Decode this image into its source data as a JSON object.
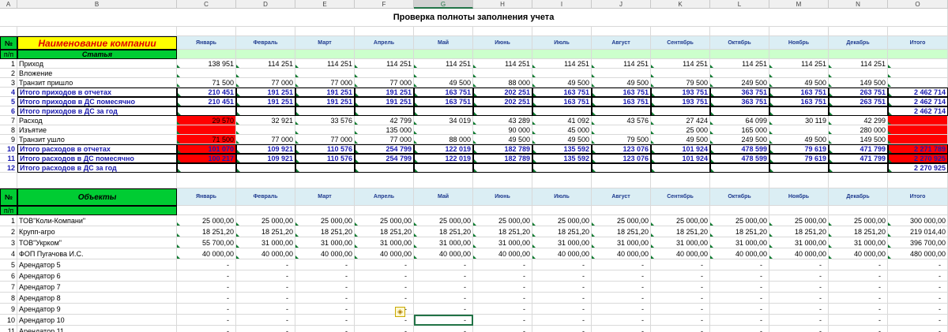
{
  "columns": [
    "A",
    "B",
    "C",
    "D",
    "E",
    "F",
    "G",
    "H",
    "I",
    "J",
    "K",
    "L",
    "M",
    "N",
    "O"
  ],
  "selected_column": "G",
  "title": "Проверка полноты заполнения учета",
  "months": [
    "Январь",
    "Февраль",
    "Март",
    "Апрель",
    "Май",
    "Июнь",
    "Июль",
    "Август",
    "Сентябрь",
    "Октябрь",
    "Ноябрь",
    "Декабрь",
    "Итого"
  ],
  "top": {
    "num_hdr": "№",
    "sub_num_hdr": "п/п",
    "company_hdr": "Наименование компании",
    "article_hdr": "Статья",
    "rows": [
      {
        "n": "1",
        "label": "Приход",
        "style": "plain",
        "vals": [
          "138 951",
          "114 251",
          "114 251",
          "114 251",
          "114 251",
          "114 251",
          "114 251",
          "114 251",
          "114 251",
          "114 251",
          "114 251",
          "114 251",
          ""
        ]
      },
      {
        "n": "2",
        "label": "Вложение",
        "style": "plain",
        "vals": [
          "",
          "",
          "",
          "",
          "",
          "",
          "",
          "",
          "",
          "",
          "",
          "",
          ""
        ]
      },
      {
        "n": "3",
        "label": "Транзит пришло",
        "style": "plain",
        "vals": [
          "71 500",
          "77 000",
          "77 000",
          "77 000",
          "49 500",
          "88 000",
          "49 500",
          "49 500",
          "79 500",
          "249 500",
          "49 500",
          "149 500",
          ""
        ]
      },
      {
        "n": "4",
        "label": "Итого приходов в отчетах",
        "style": "total",
        "vals": [
          "210 451",
          "191 251",
          "191 251",
          "191 251",
          "163 751",
          "202 251",
          "163 751",
          "163 751",
          "193 751",
          "363 751",
          "163 751",
          "263 751",
          "2 462 714"
        ]
      },
      {
        "n": "5",
        "label": "Итого приходов в ДС помесячно",
        "style": "total",
        "vals": [
          "210 451",
          "191 251",
          "191 251",
          "191 251",
          "163 751",
          "202 251",
          "163 751",
          "163 751",
          "193 751",
          "363 751",
          "163 751",
          "263 751",
          "2 462 714"
        ]
      },
      {
        "n": "6",
        "label": "Итого приходов в ДС за год",
        "style": "year",
        "vals": [
          "",
          "",
          "",
          "",
          "",
          "",
          "",
          "",
          "",
          "",
          "",
          "",
          "2 462 714"
        ]
      },
      {
        "n": "7",
        "label": "Расход",
        "style": "plain",
        "vals": [
          "29 570",
          "32 921",
          "33 576",
          "42 799",
          "34 019",
          "43 289",
          "41 092",
          "43 576",
          "27 424",
          "64 099",
          "30 119",
          "42 299",
          ""
        ]
      },
      {
        "n": "8",
        "label": "Изъятие",
        "style": "plain",
        "vals": [
          "",
          "",
          "",
          "135 000",
          "",
          "90 000",
          "45 000",
          "",
          "25 000",
          "165 000",
          "",
          "280 000",
          ""
        ]
      },
      {
        "n": "9",
        "label": "Транзит ушло",
        "style": "plain",
        "vals": [
          "71 500",
          "77 000",
          "77 000",
          "77 000",
          "88 000",
          "49 500",
          "49 500",
          "79 500",
          "49 500",
          "249 500",
          "49 500",
          "149 500",
          ""
        ]
      },
      {
        "n": "10",
        "label": "Итого расходов в отчетах",
        "style": "total",
        "vals": [
          "101 070",
          "109 921",
          "110 576",
          "254 799",
          "122 019",
          "182 789",
          "135 592",
          "123 076",
          "101 924",
          "478 599",
          "79 619",
          "471 799",
          "2 271 789"
        ]
      },
      {
        "n": "11",
        "label": "Итого расходов в ДС помесячно",
        "style": "total",
        "vals": [
          "100 217",
          "109 921",
          "110 576",
          "254 799",
          "122 019",
          "182 789",
          "135 592",
          "123 076",
          "101 924",
          "478 599",
          "79 619",
          "471 799",
          "2 270 925"
        ]
      },
      {
        "n": "12",
        "label": "Итого расходов в ДС за год",
        "style": "year",
        "vals": [
          "",
          "",
          "",
          "",
          "",
          "",
          "",
          "",
          "",
          "",
          "",
          "",
          "2 270 925"
        ]
      }
    ]
  },
  "objects": {
    "num_hdr": "№",
    "sub_num_hdr": "п/п",
    "objects_hdr": "Объекты",
    "rows": [
      {
        "n": "1",
        "label": "ТОВ\"Коли-Компани\"",
        "vals": [
          "25 000,00",
          "25 000,00",
          "25 000,00",
          "25 000,00",
          "25 000,00",
          "25 000,00",
          "25 000,00",
          "25 000,00",
          "25 000,00",
          "25 000,00",
          "25 000,00",
          "25 000,00",
          "300 000,00"
        ]
      },
      {
        "n": "2",
        "label": "Крупп-агро",
        "vals": [
          "18 251,20",
          "18 251,20",
          "18 251,20",
          "18 251,20",
          "18 251,20",
          "18 251,20",
          "18 251,20",
          "18 251,20",
          "18 251,20",
          "18 251,20",
          "18 251,20",
          "18 251,20",
          "219 014,40"
        ]
      },
      {
        "n": "3",
        "label": "ТОВ\"Укрком\"",
        "vals": [
          "55 700,00",
          "31 000,00",
          "31 000,00",
          "31 000,00",
          "31 000,00",
          "31 000,00",
          "31 000,00",
          "31 000,00",
          "31 000,00",
          "31 000,00",
          "31 000,00",
          "31 000,00",
          "396 700,00"
        ]
      },
      {
        "n": "4",
        "label": "ФОП Пугачова И.С.",
        "vals": [
          "40 000,00",
          "40 000,00",
          "40 000,00",
          "40 000,00",
          "40 000,00",
          "40 000,00",
          "40 000,00",
          "40 000,00",
          "40 000,00",
          "40 000,00",
          "40 000,00",
          "40 000,00",
          "480 000,00"
        ]
      },
      {
        "n": "5",
        "label": "Арендатор 5",
        "vals": [
          "-",
          "-",
          "-",
          "-",
          "-",
          "-",
          "-",
          "-",
          "-",
          "-",
          "-",
          "-",
          "-"
        ]
      },
      {
        "n": "6",
        "label": "Арендатор 6",
        "vals": [
          "-",
          "-",
          "-",
          "-",
          "-",
          "-",
          "-",
          "-",
          "-",
          "-",
          "-",
          "-",
          "-"
        ]
      },
      {
        "n": "7",
        "label": "Арендатор 7",
        "vals": [
          "-",
          "-",
          "-",
          "-",
          "-",
          "-",
          "-",
          "-",
          "-",
          "-",
          "-",
          "-",
          "-"
        ]
      },
      {
        "n": "8",
        "label": "Арендатор 8",
        "vals": [
          "-",
          "-",
          "-",
          "-",
          "-",
          "-",
          "-",
          "-",
          "-",
          "-",
          "-",
          "-",
          "-"
        ]
      },
      {
        "n": "9",
        "label": "Арендатор 9",
        "vals": [
          "-",
          "-",
          "-",
          "-",
          "-",
          "-",
          "-",
          "-",
          "-",
          "-",
          "-",
          "-",
          "-"
        ]
      },
      {
        "n": "10",
        "label": "Арендатор 10",
        "vals": [
          "-",
          "-",
          "-",
          "-",
          "-",
          "-",
          "-",
          "-",
          "-",
          "-",
          "-",
          "-",
          "-"
        ]
      },
      {
        "n": "11",
        "label": "Арендатор 11",
        "vals": [
          "-",
          "-",
          "-",
          "-",
          "-",
          "-",
          "-",
          "-",
          "-",
          "-",
          "-",
          "-",
          "-"
        ]
      }
    ]
  },
  "colors": {
    "header_green": "#00cc33",
    "company_yellow": "#ffff00",
    "error_red": "#ff0000",
    "month_header": "#dbeef4",
    "total_text": "#1a1ab0"
  }
}
